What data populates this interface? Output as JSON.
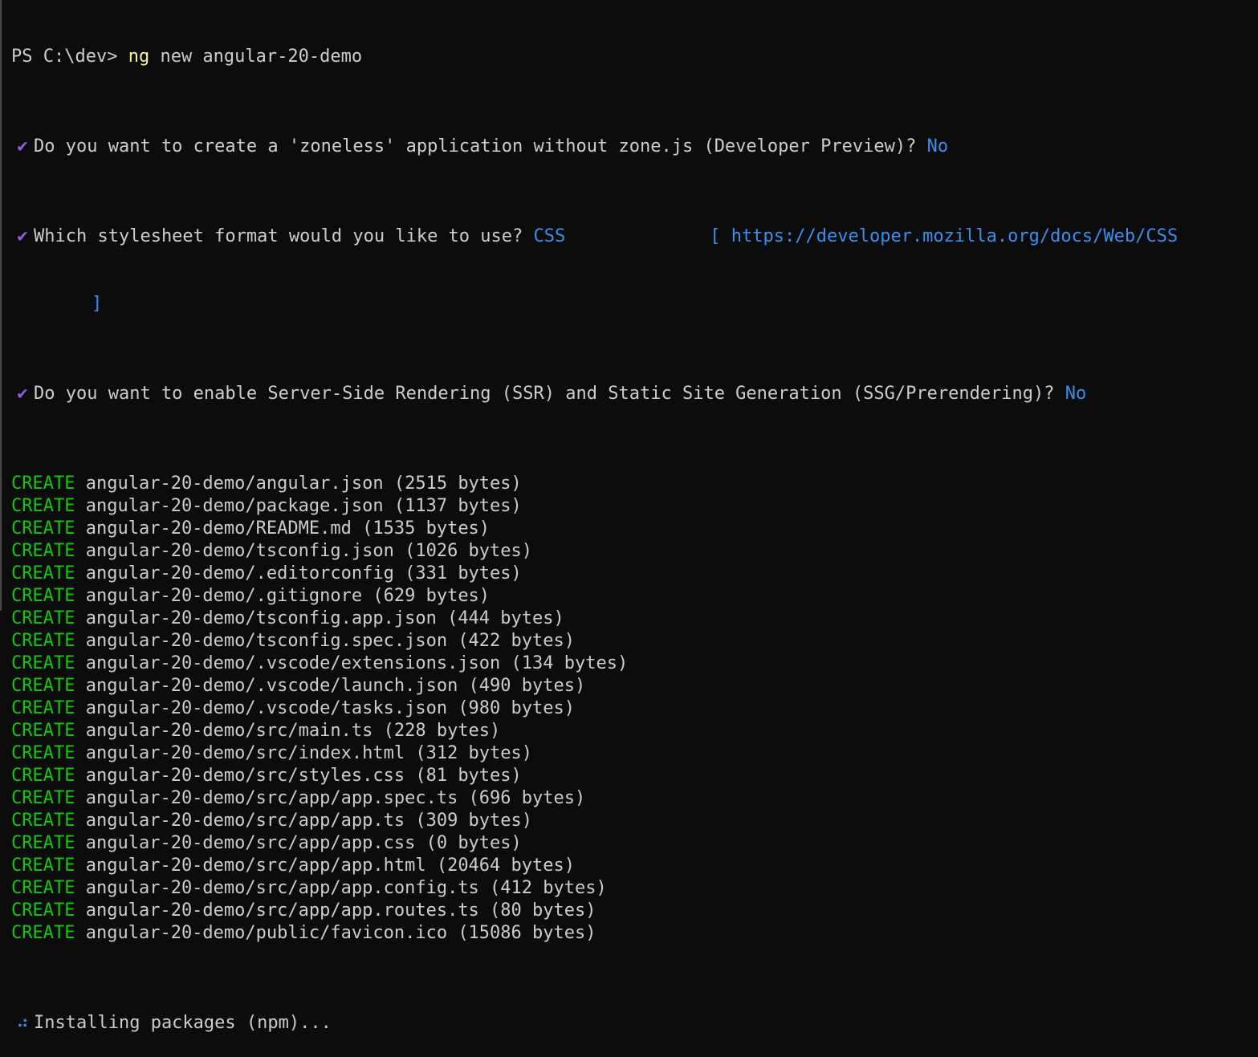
{
  "terminal": {
    "prompt": {
      "ps": "PS C:\\dev> ",
      "cmd": "ng",
      "args": " new angular-20-demo"
    },
    "questions": [
      {
        "icon": "checkmark-icon",
        "text": "Do you want to create a 'zoneless' application without zone.js (Developer Preview)? ",
        "answer": "No"
      },
      {
        "icon": "checkmark-icon",
        "text": "Which stylesheet format would you like to use? ",
        "answer": "CSS",
        "link": "[ https://developer.mozilla.org/docs/Web/CSS",
        "link_close": "]"
      },
      {
        "icon": "checkmark-icon",
        "text": "Do you want to enable Server-Side Rendering (SSR) and Static Site Generation (SSG/Prerendering)? ",
        "answer": "No"
      }
    ],
    "create_label": "CREATE",
    "files": [
      "angular-20-demo/angular.json (2515 bytes)",
      "angular-20-demo/package.json (1137 bytes)",
      "angular-20-demo/README.md (1535 bytes)",
      "angular-20-demo/tsconfig.json (1026 bytes)",
      "angular-20-demo/.editorconfig (331 bytes)",
      "angular-20-demo/.gitignore (629 bytes)",
      "angular-20-demo/tsconfig.app.json (444 bytes)",
      "angular-20-demo/tsconfig.spec.json (422 bytes)",
      "angular-20-demo/.vscode/extensions.json (134 bytes)",
      "angular-20-demo/.vscode/launch.json (490 bytes)",
      "angular-20-demo/.vscode/tasks.json (980 bytes)",
      "angular-20-demo/src/main.ts (228 bytes)",
      "angular-20-demo/src/index.html (312 bytes)",
      "angular-20-demo/src/styles.css (81 bytes)",
      "angular-20-demo/src/app/app.spec.ts (696 bytes)",
      "angular-20-demo/src/app/app.ts (309 bytes)",
      "angular-20-demo/src/app/app.css (0 bytes)",
      "angular-20-demo/src/app/app.html (20464 bytes)",
      "angular-20-demo/src/app/app.config.ts (412 bytes)",
      "angular-20-demo/src/app/app.routes.ts (80 bytes)",
      "angular-20-demo/public/favicon.ico (15086 bytes)"
    ],
    "status": {
      "icon": "spinner-icon",
      "text": "Installing packages (npm)..."
    },
    "colors": {
      "background": "#0c0c0c",
      "text": "#cccccc",
      "command": "#f9f1a5",
      "answer": "#3b8eea",
      "create": "#16c60c",
      "check": "#8f60d7"
    }
  }
}
